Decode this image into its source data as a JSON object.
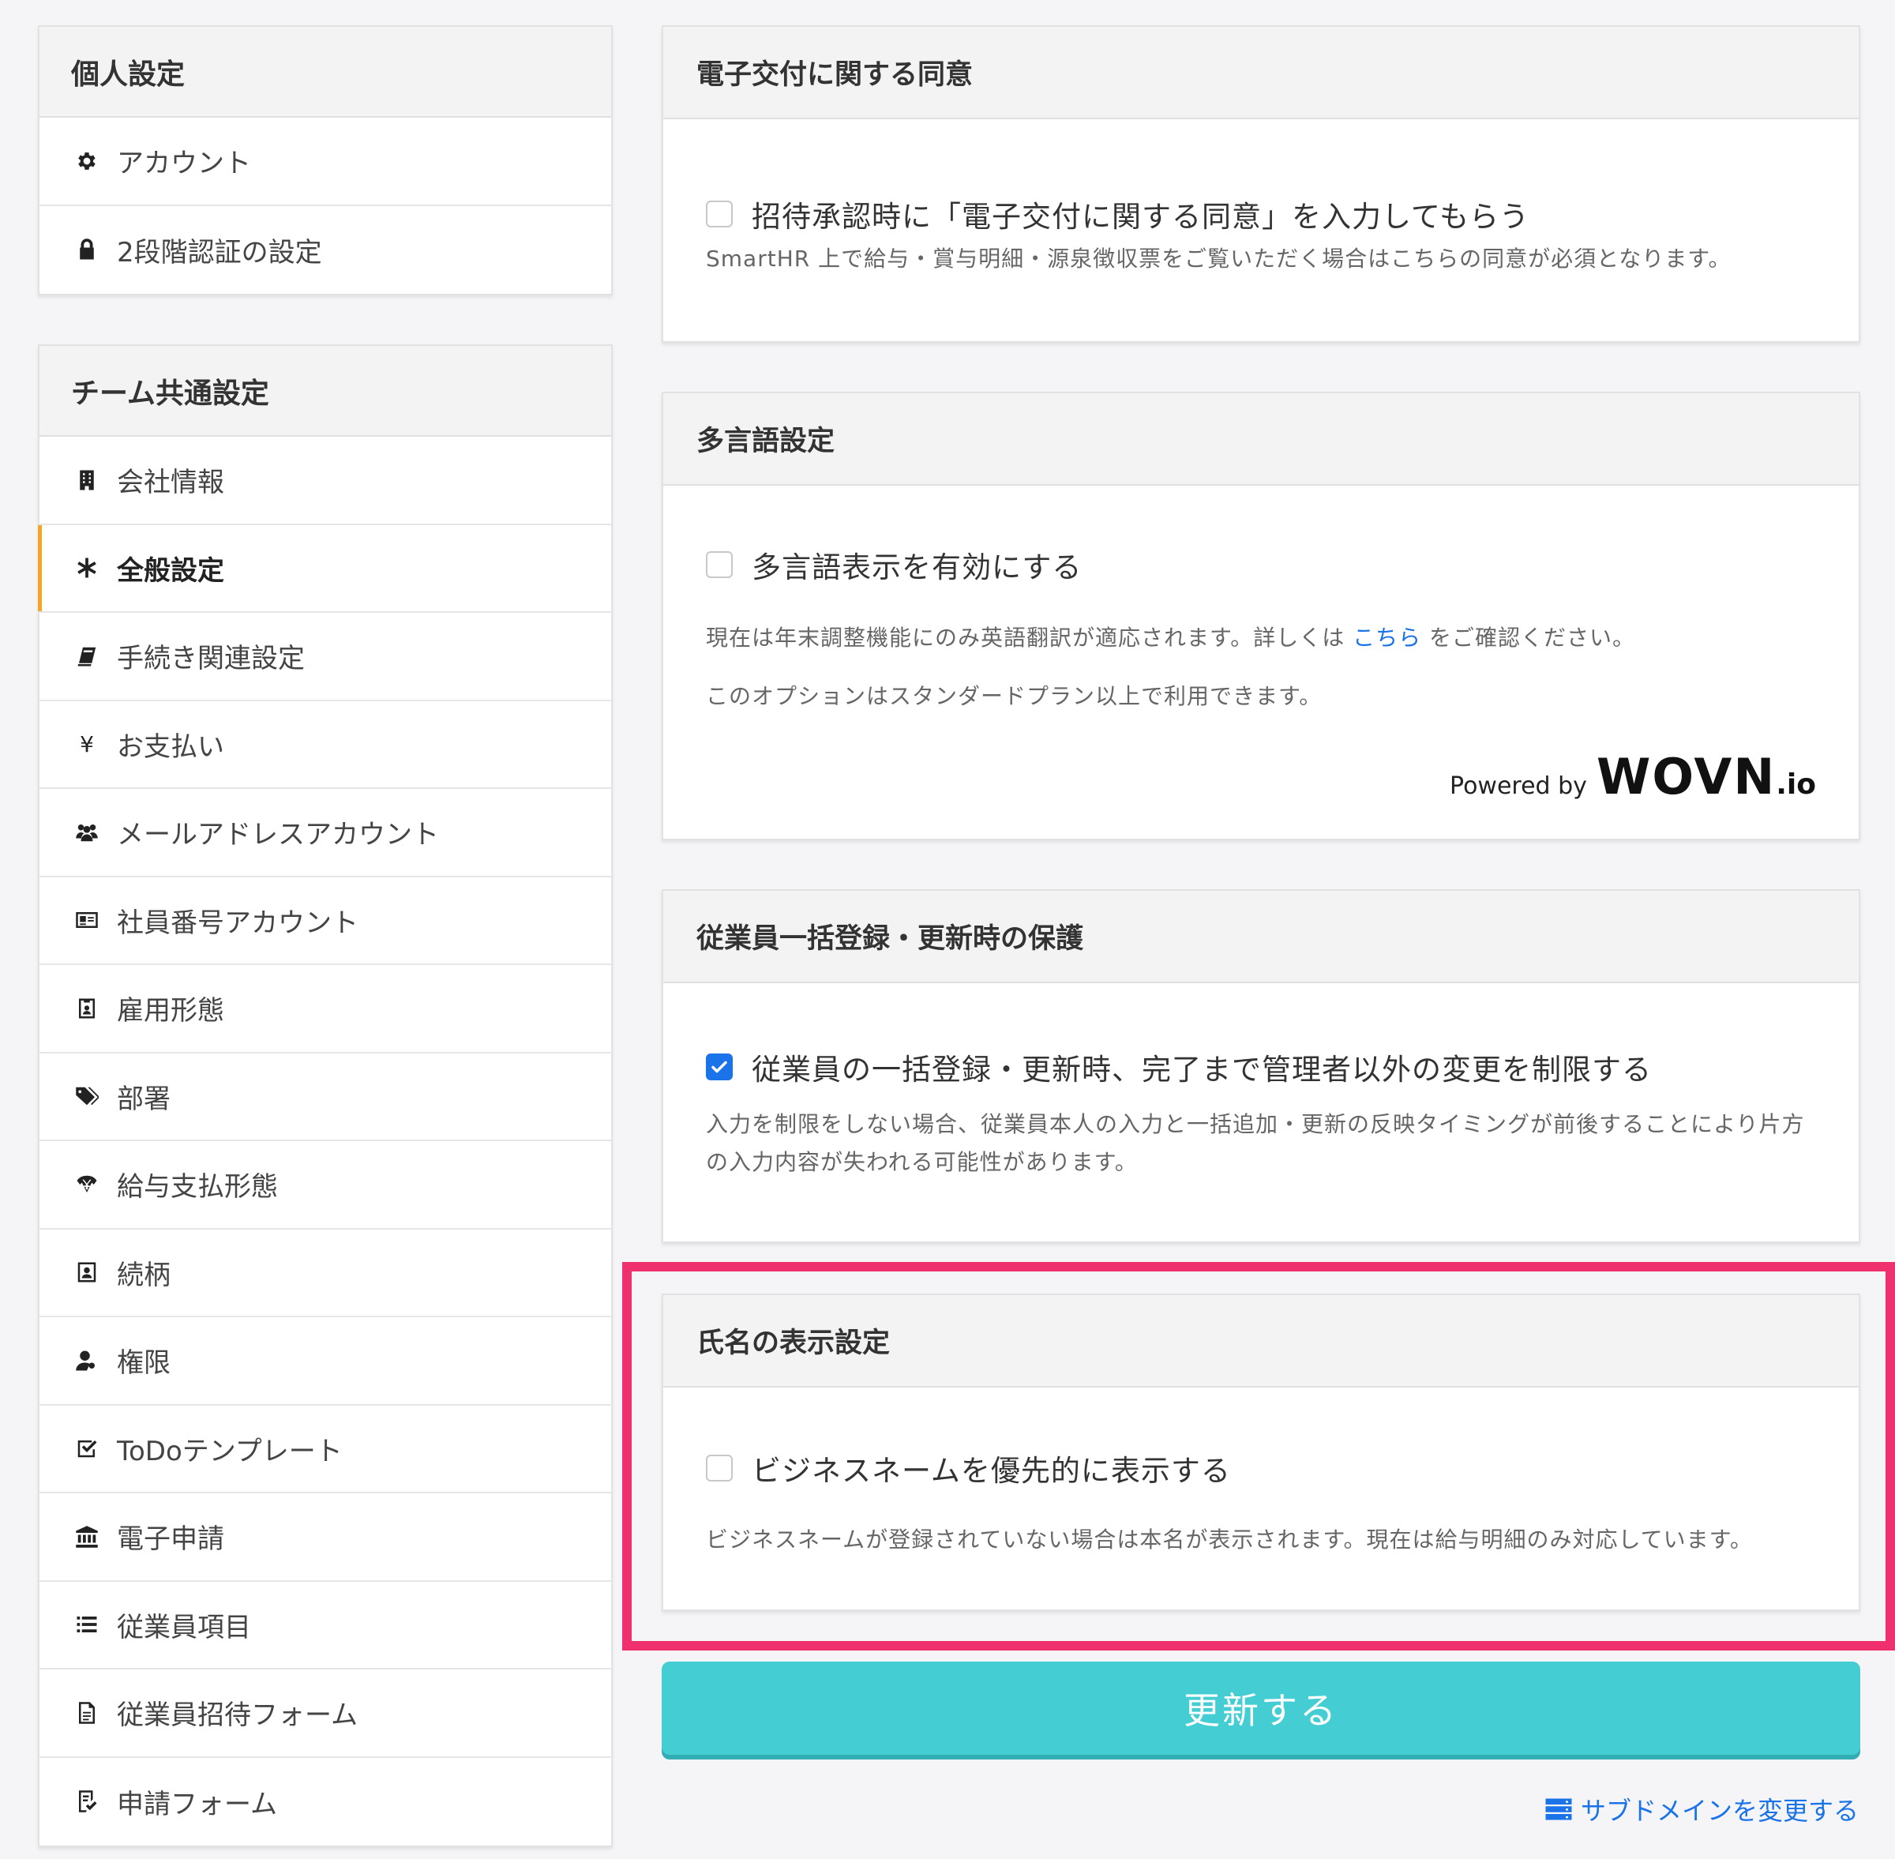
{
  "sidebar": {
    "personal": {
      "title": "個人設定",
      "items": [
        {
          "label": "アカウント"
        },
        {
          "label": "2段階認証の設定"
        }
      ]
    },
    "team": {
      "title": "チーム共通設定",
      "items": [
        {
          "label": "会社情報"
        },
        {
          "label": "全般設定"
        },
        {
          "label": "手続き関連設定"
        },
        {
          "label": "お支払い"
        },
        {
          "label": "メールアドレスアカウント"
        },
        {
          "label": "社員番号アカウント"
        },
        {
          "label": "雇用形態"
        },
        {
          "label": "部署"
        },
        {
          "label": "給与支払形態"
        },
        {
          "label": "続柄"
        },
        {
          "label": "権限"
        },
        {
          "label": "ToDoテンプレート"
        },
        {
          "label": "電子申請"
        },
        {
          "label": "従業員項目"
        },
        {
          "label": "従業員招待フォーム"
        },
        {
          "label": "申請フォーム"
        }
      ]
    },
    "active_item": "全般設定",
    "active_color": "#f5a623"
  },
  "panels": {
    "consent": {
      "title": "電子交付に関する同意",
      "option_label": "招待承認時に「電子交付に関する同意」を入力してもらう",
      "checked": false,
      "description": "SmartHR 上で給与・賞与明細・源泉徴収票をご覧いただく場合はこちらの同意が必須となります。"
    },
    "multilang": {
      "title": "多言語設定",
      "option_label": "多言語表示を有効にする",
      "checked": false,
      "description_before": "現在は年末調整機能にのみ英語翻訳が適応されます。詳しくは",
      "description_link": "こちら",
      "description_after": "をご確認ください。",
      "description2": "このオプションはスタンダードプラン以上で利用できます。",
      "powered_by": "Powered by",
      "wovn_logo": "WOVN",
      "wovn_suffix": ".io"
    },
    "protection": {
      "title": "従業員一括登録・更新時の保護",
      "option_label": "従業員の一括登録・更新時、完了まで管理者以外の変更を制限する",
      "checked": true,
      "description": "入力を制限をしない場合、従業員本人の入力と一括追加・更新の反映タイミングが前後することにより片方の入力内容が失われる可能性があります。"
    },
    "name_display": {
      "title": "氏名の表示設定",
      "option_label": "ビジネスネームを優先的に表示する",
      "checked": false,
      "description": "ビジネスネームが登録されていない場合は本名が表示されます。現在は給与明細のみ対応しています。"
    }
  },
  "actions": {
    "update_label": "更新する",
    "subdomain_label": "サブドメインを変更する"
  },
  "colors": {
    "highlight": "#f0306e",
    "button": "#45cdd4",
    "link": "#1a73e8"
  }
}
